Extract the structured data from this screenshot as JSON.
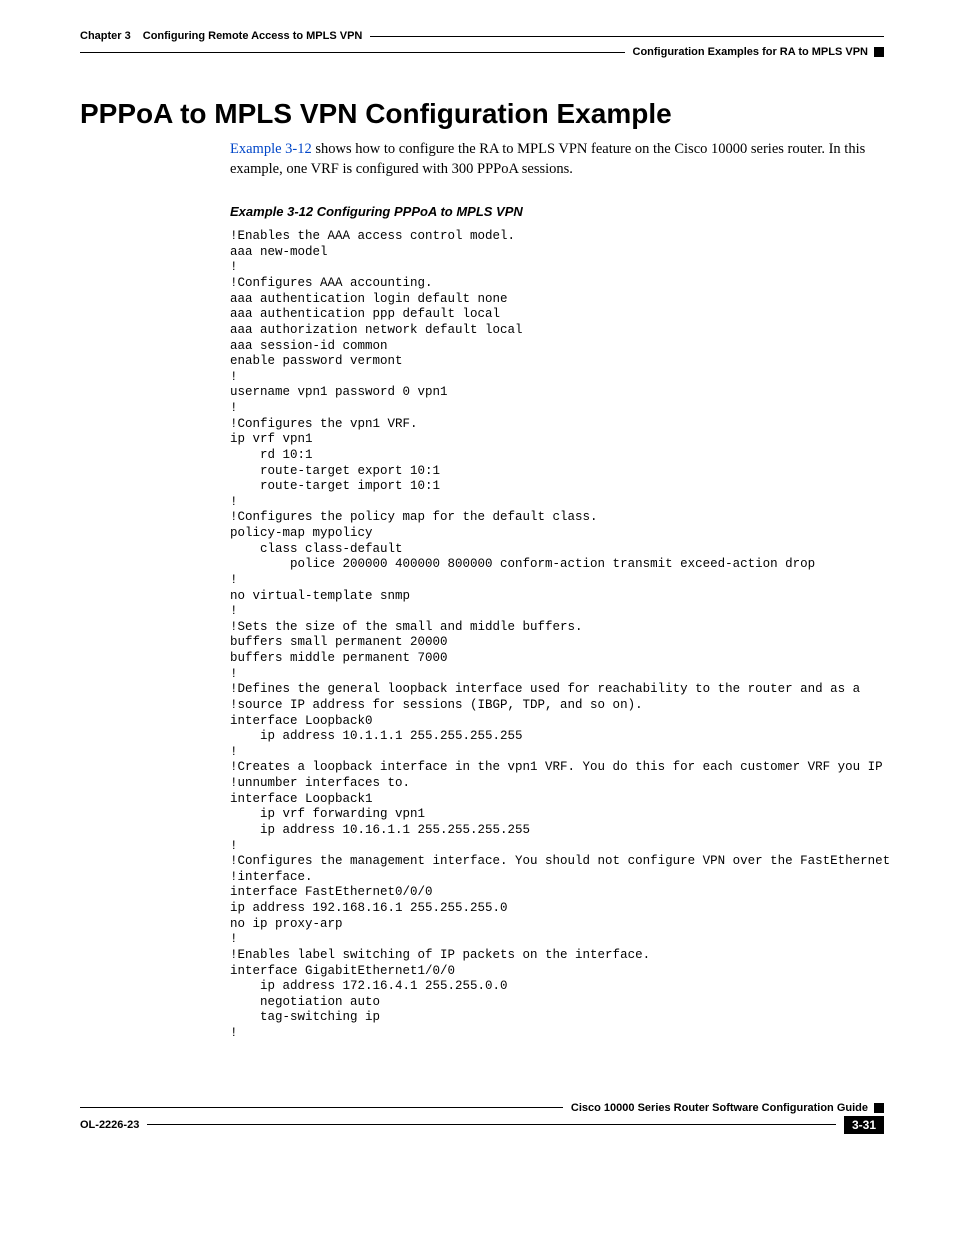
{
  "header": {
    "chapter": "Chapter 3",
    "chapter_title": "Configuring Remote Access to MPLS VPN",
    "section_label": "Configuration Examples for RA to MPLS VPN"
  },
  "section_title": "PPPoA to MPLS VPN Configuration Example",
  "intro": {
    "link_text": "Example 3-12",
    "rest": " shows how to configure the RA to MPLS VPN feature on the Cisco 10000 series router. In this example, one VRF is configured with 300 PPPoA sessions."
  },
  "example_caption": "Example 3-12   Configuring PPPoA to MPLS VPN",
  "code": "!Enables the AAA access control model.\naaa new-model\n!\n!Configures AAA accounting.\naaa authentication login default none\naaa authentication ppp default local\naaa authorization network default local\naaa session-id common\nenable password vermont\n!\nusername vpn1 password 0 vpn1\n!\n!Configures the vpn1 VRF.\nip vrf vpn1\n    rd 10:1\n    route-target export 10:1\n    route-target import 10:1\n!\n!Configures the policy map for the default class.\npolicy-map mypolicy\n    class class-default\n        police 200000 400000 800000 conform-action transmit exceed-action drop\n!\nno virtual-template snmp\n!\n!Sets the size of the small and middle buffers.\nbuffers small permanent 20000\nbuffers middle permanent 7000\n!\n!Defines the general loopback interface used for reachability to the router and as a\n!source IP address for sessions (IBGP, TDP, and so on).\ninterface Loopback0\n    ip address 10.1.1.1 255.255.255.255\n!\n!Creates a loopback interface in the vpn1 VRF. You do this for each customer VRF you IP\n!unnumber interfaces to.\ninterface Loopback1\n    ip vrf forwarding vpn1\n    ip address 10.16.1.1 255.255.255.255\n!\n!Configures the management interface. You should not configure VPN over the FastEthernet\n!interface.\ninterface FastEthernet0/0/0\nip address 192.168.16.1 255.255.255.0\nno ip proxy-arp\n!\n!Enables label switching of IP packets on the interface.\ninterface GigabitEthernet1/0/0\n    ip address 172.16.4.1 255.255.0.0\n    negotiation auto\n    tag-switching ip\n!",
  "footer": {
    "doc_title": "Cisco 10000 Series Router Software Configuration Guide",
    "doc_id": "OL-2226-23",
    "page_number": "3-31"
  }
}
